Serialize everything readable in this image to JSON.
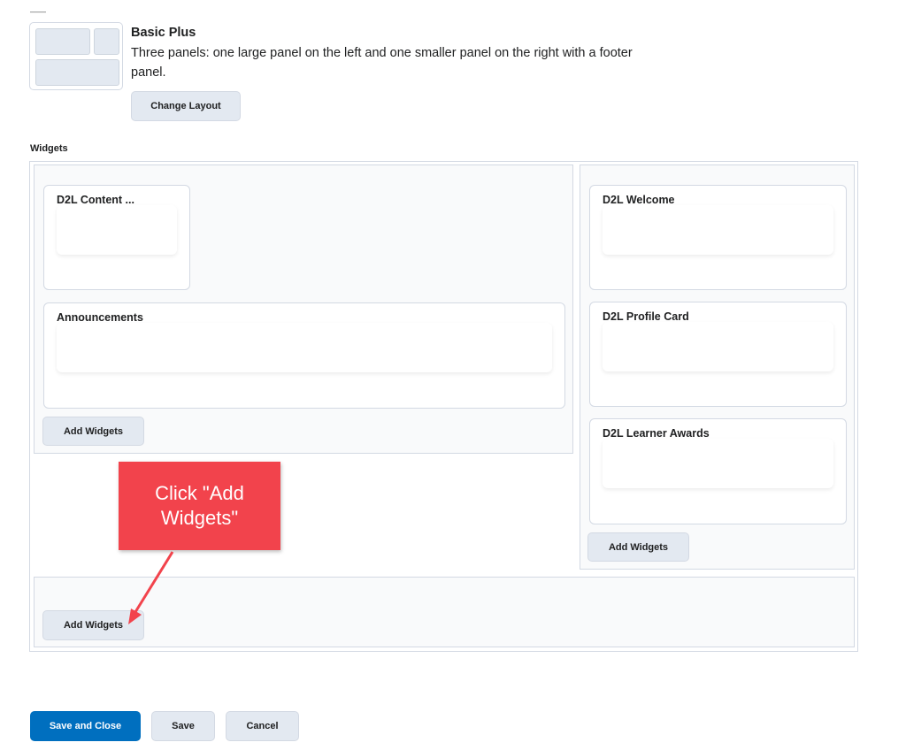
{
  "layout": {
    "name": "Basic Plus",
    "description": "Three panels: one large panel on the left and one smaller panel on the right with a footer panel.",
    "change_label": "Change Layout"
  },
  "widgets_section": {
    "label": "Widgets",
    "left_panel": {
      "cards": [
        "D2L Content ...",
        "Announcements"
      ],
      "add_label": "Add Widgets"
    },
    "right_panel": {
      "cards": [
        "D2L Welcome",
        "D2L Profile Card",
        "D2L Learner Awards"
      ],
      "add_label": "Add Widgets"
    },
    "footer_panel": {
      "add_label": "Add Widgets"
    }
  },
  "callout": {
    "text": "Click \"Add Widgets\"",
    "color": "#f2434c"
  },
  "actions": {
    "save_close": "Save and Close",
    "save": "Save",
    "cancel": "Cancel"
  },
  "colors": {
    "primary": "#006fbf",
    "button_bg": "#e3e9f1",
    "border": "#d3d9e3"
  }
}
